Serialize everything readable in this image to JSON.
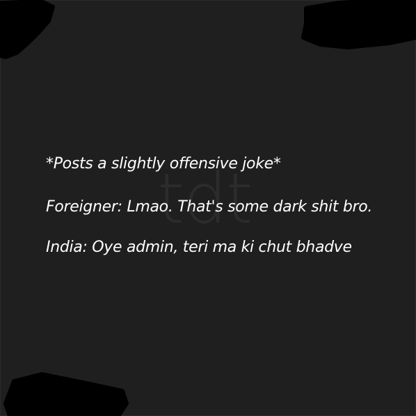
{
  "post": {
    "watermark": "tdt",
    "lines": [
      "*Posts a slightly offensive joke*",
      "Foreigner: Lmao. That's some dark shit bro.",
      "India: Oye admin, teri ma ki chut bhadve"
    ]
  },
  "colors": {
    "background": "#1f1f1f",
    "text": "#ffffff",
    "watermark": "#2c2c2c",
    "redaction": "#000000"
  }
}
